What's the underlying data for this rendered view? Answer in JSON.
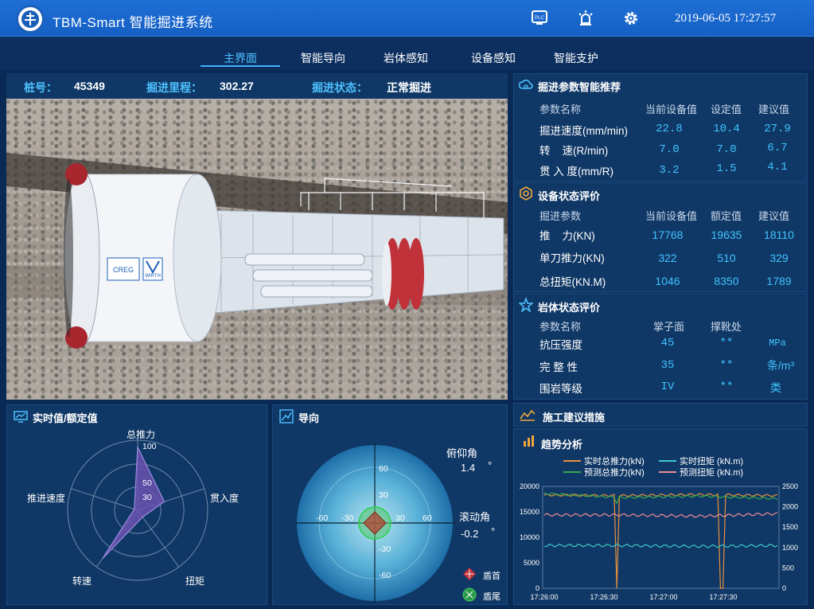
{
  "header": {
    "title": "TBM-Smart 智能掘进系统",
    "datetime": "2019-06-05 17:27:57"
  },
  "nav": {
    "tabs": [
      {
        "label": "主界面",
        "active": true
      },
      {
        "label": "智能导向",
        "active": false
      },
      {
        "label": "岩体感知",
        "active": false
      },
      {
        "label": "设备感知",
        "active": false
      },
      {
        "label": "智能支护",
        "active": false
      }
    ]
  },
  "status": {
    "pile_label": "桩号：",
    "pile_value": "45349",
    "mileage_label": "掘进里程：",
    "mileage_value": "302.27",
    "state_label": "掘进状态：",
    "state_value": "正常掘进"
  },
  "scene": {
    "brand1": "CREG",
    "brand2": "WIRTH"
  },
  "param_panel": {
    "title": "掘进参数智能推荐",
    "headers": [
      "参数名称",
      "当前设备值",
      "设定值",
      "建议值"
    ],
    "rows": [
      {
        "name": "掘进速度(mm/min)",
        "current": "22.8",
        "set": "10.4",
        "advice": "27.9"
      },
      {
        "name": "转    速(R/min)",
        "current": "7.0",
        "set": "7.0",
        "advice": "6.7"
      },
      {
        "name": "贯 入 度(mm/R)",
        "current": "3.2",
        "set": "1.5",
        "advice": "4.1"
      }
    ]
  },
  "device_panel": {
    "title": "设备状态评价",
    "headers": [
      "掘进参数",
      "当前设备值",
      "额定值",
      "建议值"
    ],
    "rows": [
      {
        "name": "推    力(KN)",
        "current": "17768",
        "rated": "19635",
        "advice": "18110"
      },
      {
        "name": "单刀推力(KN)",
        "current": "322",
        "rated": "510",
        "advice": "329"
      },
      {
        "name": "总扭矩(KN.M)",
        "current": "1046",
        "rated": "8350",
        "advice": "1789"
      }
    ]
  },
  "rock_panel": {
    "title": "岩体状态评价",
    "headers": [
      "参数名称",
      "掌子面",
      "撑靴处"
    ],
    "rows": [
      {
        "name": "抗压强度",
        "face": "45",
        "shoe": "**",
        "unit": "MPa"
      },
      {
        "name": "完 整 性",
        "face": "35",
        "shoe": "**",
        "unit": "条/m³"
      },
      {
        "name": "围岩等级",
        "face": "IV",
        "shoe": "**",
        "unit": "类"
      }
    ]
  },
  "radar": {
    "title": "实时值/额定值",
    "axes": [
      "总推力",
      "贯入度",
      "扭矩",
      "转速",
      "推进速度"
    ],
    "ticks": [
      "100",
      "50",
      "30"
    ],
    "values_pct": [
      90,
      40,
      12,
      85,
      5
    ]
  },
  "guide": {
    "title": "导向",
    "pitch_label": "俯仰角",
    "pitch_value": "1.4",
    "pitch_unit": "°",
    "roll_label": "滚动角",
    "roll_value": "-0.2",
    "roll_unit": "°",
    "ticks_h": [
      "-60",
      "-30",
      "30",
      "60"
    ],
    "ticks_v": [
      "60",
      "30",
      "-30",
      "-60"
    ],
    "legend_head": "盾首",
    "legend_tail": "盾尾"
  },
  "advice_panel": {
    "title": "施工建议措施"
  },
  "trend": {
    "title": "趋势分析",
    "legend": [
      {
        "name": "实时总推力(kN)",
        "color": "#e8903c"
      },
      {
        "name": "实时扭矩 (kN.m)",
        "color": "#3ec8c8"
      },
      {
        "name": "预测总推力(kN)",
        "color": "#3aa84a"
      },
      {
        "name": "预测扭矩 (kN.m)",
        "color": "#f08a96"
      }
    ],
    "y_left": [
      "20000",
      "15000",
      "10000",
      "5000",
      "0"
    ],
    "y_right": [
      "2500",
      "2000",
      "1500",
      "1000",
      "500",
      "0"
    ],
    "x_ticks": [
      "17:26:00",
      "17:26:30",
      "17:27:00",
      "17:27:30"
    ]
  },
  "chart_data": {
    "type": "line",
    "x": [
      "17:26:00",
      "17:26:30",
      "17:27:00",
      "17:27:30"
    ],
    "ylim_left": [
      0,
      20000
    ],
    "ylim_right": [
      0,
      2500
    ],
    "series": [
      {
        "name": "实时总推力(kN)",
        "axis": "left",
        "values": [
          18300,
          18200,
          18400,
          18200
        ]
      },
      {
        "name": "预测总推力(kN)",
        "axis": "left",
        "values": [
          18600,
          17800,
          18100,
          17600
        ]
      },
      {
        "name": "实时扭矩 (kN.m)",
        "axis": "right",
        "values": [
          1050,
          1050,
          1030,
          1050
        ]
      },
      {
        "name": "预测扭矩 (kN.m)",
        "axis": "right",
        "values": [
          1800,
          1800,
          1770,
          1830
        ]
      }
    ]
  }
}
